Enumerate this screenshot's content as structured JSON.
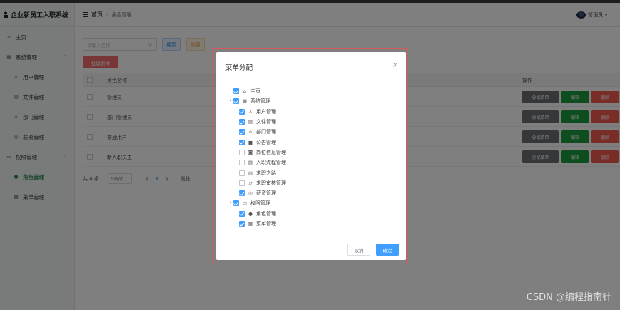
{
  "app": {
    "title": "企业新员工入职系统"
  },
  "header": {
    "home": "首页",
    "separator": "/",
    "current": "角色管理",
    "user": "管理员"
  },
  "sidebar": {
    "items": [
      {
        "label": "主页",
        "icon": "home-icon"
      },
      {
        "label": "系统管理",
        "icon": "grid-icon"
      },
      {
        "label": "用户管理",
        "icon": "user-icon"
      },
      {
        "label": "文件管理",
        "icon": "file-icon"
      },
      {
        "label": "部门管理",
        "icon": "house-icon"
      },
      {
        "label": "薪资管理",
        "icon": "coin-icon"
      },
      {
        "label": "权限管理",
        "icon": "monitor-icon"
      },
      {
        "label": "角色管理",
        "icon": "person-icon"
      },
      {
        "label": "菜单管理",
        "icon": "menu-grid-icon"
      }
    ]
  },
  "search": {
    "placeholder": "请输入名称",
    "button": "搜索",
    "reset": "重置"
  },
  "toolbar": {
    "batch_delete": "批量删除"
  },
  "table": {
    "headers": {
      "name": "角色名称",
      "ops": "操作"
    },
    "rows": [
      {
        "name": "管理员"
      },
      {
        "name": "部门管理员"
      },
      {
        "name": "普通用户"
      },
      {
        "name": "新入职员工"
      }
    ],
    "ops": {
      "assign": "分配菜单",
      "edit": "编辑",
      "delete": "删除"
    }
  },
  "pagination": {
    "total": "共 4 条",
    "page_size": "5条/页",
    "prev": "<",
    "current": "1",
    "next": ">",
    "goto": "前往"
  },
  "dialog": {
    "title": "菜单分配",
    "close": "×",
    "tree": [
      {
        "label": "主页",
        "icon": "home-icon",
        "checked": true,
        "level": 1,
        "arrow": ""
      },
      {
        "label": "系统管理",
        "icon": "grid-icon",
        "checked": true,
        "level": 1,
        "arrow": "▾"
      },
      {
        "label": "用户管理",
        "icon": "user-icon",
        "checked": true,
        "level": 2
      },
      {
        "label": "文件管理",
        "icon": "file-icon",
        "checked": true,
        "level": 2
      },
      {
        "label": "部门管理",
        "icon": "house-icon",
        "checked": true,
        "level": 2
      },
      {
        "label": "公告管理",
        "icon": "chat-icon",
        "checked": true,
        "level": 2
      },
      {
        "label": "岗位信息管理",
        "icon": "camera-icon",
        "checked": false,
        "level": 2
      },
      {
        "label": "入职流程管理",
        "icon": "doc-icon",
        "checked": false,
        "level": 2
      },
      {
        "label": "求职之路",
        "icon": "list-icon",
        "checked": false,
        "level": 2
      },
      {
        "label": "求职审核管理",
        "icon": "folder-icon",
        "checked": false,
        "level": 2
      },
      {
        "label": "薪资管理",
        "icon": "coin-icon",
        "checked": true,
        "level": 2
      },
      {
        "label": "权限管理",
        "icon": "monitor-icon",
        "checked": true,
        "level": 1,
        "arrow": "▾"
      },
      {
        "label": "角色管理",
        "icon": "person-icon",
        "checked": true,
        "level": 2
      },
      {
        "label": "菜单管理",
        "icon": "menu-grid-icon",
        "checked": true,
        "level": 2
      }
    ],
    "cancel": "取消",
    "confirm": "确定"
  },
  "watermark": "CSDN @编程指南针"
}
